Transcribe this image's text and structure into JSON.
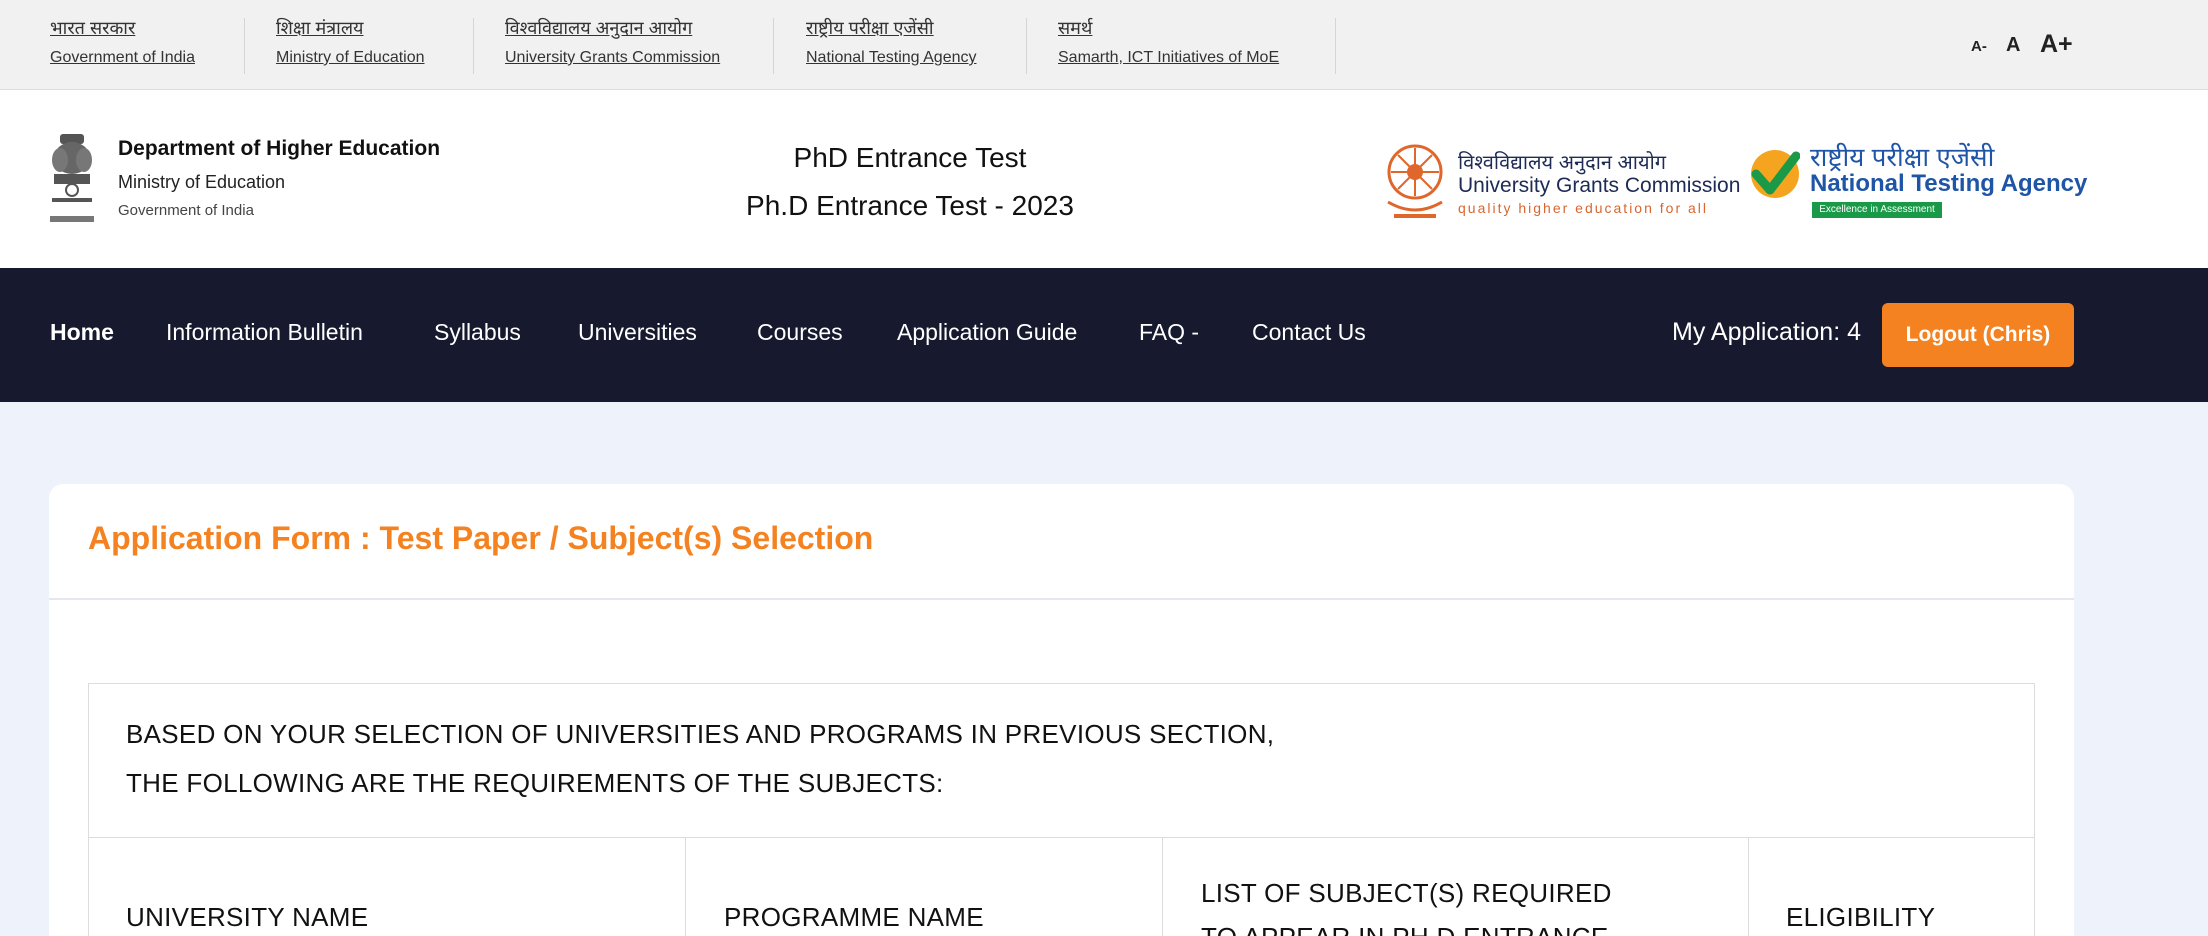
{
  "gov_links": [
    {
      "hi": "भारत सरकार",
      "en": "Government of India"
    },
    {
      "hi": "शिक्षा मंत्रालय",
      "en": "Ministry of Education"
    },
    {
      "hi": "विश्वविद्यालय अनुदान आयोग",
      "en": "University Grants Commission"
    },
    {
      "hi": "राष्ट्रीय परीक्षा एजेंसी",
      "en": "National Testing Agency"
    },
    {
      "hi": "समर्थ",
      "en": "Samarth, ICT Initiatives of MoE"
    }
  ],
  "font_controls": [
    "A-",
    "A",
    "A+"
  ],
  "department": {
    "title": "Department of Higher Education",
    "ministry": "Ministry of Education",
    "government": "Government of India"
  },
  "exam": {
    "line1": "PhD Entrance Test",
    "line2": "Ph.D Entrance Test - 2023"
  },
  "ugc": {
    "hindi": "विश्वविद्यालय अनुदान आयोग",
    "english": "University Grants Commission",
    "tagline": "quality higher education for all"
  },
  "nta": {
    "hindi": "राष्ट्रीय परीक्षा एजेंसी",
    "english": "National Testing Agency",
    "badge": "Excellence in Assessment"
  },
  "nav": {
    "items": [
      "Home",
      "Information Bulletin",
      "Syllabus",
      "Universities",
      "Courses",
      "Application Guide",
      "FAQ -",
      "Contact Us"
    ],
    "my_application": "My Application: 4",
    "logout": "Logout (Chris)"
  },
  "form": {
    "title": "Application Form : Test Paper / Subject(s) Selection",
    "requirements_line1": "BASED ON YOUR SELECTION OF UNIVERSITIES AND PROGRAMS IN PREVIOUS SECTION,",
    "requirements_line2": "THE FOLLOWING ARE THE REQUIREMENTS OF THE SUBJECTS:",
    "columns": {
      "university": "UNIVERSITY NAME",
      "programme": "PROGRAMME NAME",
      "subjects_line1": "LIST OF SUBJECT(S) REQUIRED",
      "subjects_line2": "TO APPEAR IN PH.D ENTRANCE",
      "eligibility": "ELIGIBILITY"
    }
  },
  "colors": {
    "accent": "#f48221",
    "nav_bg": "#171a2e",
    "page_bg": "#eef2fb"
  }
}
